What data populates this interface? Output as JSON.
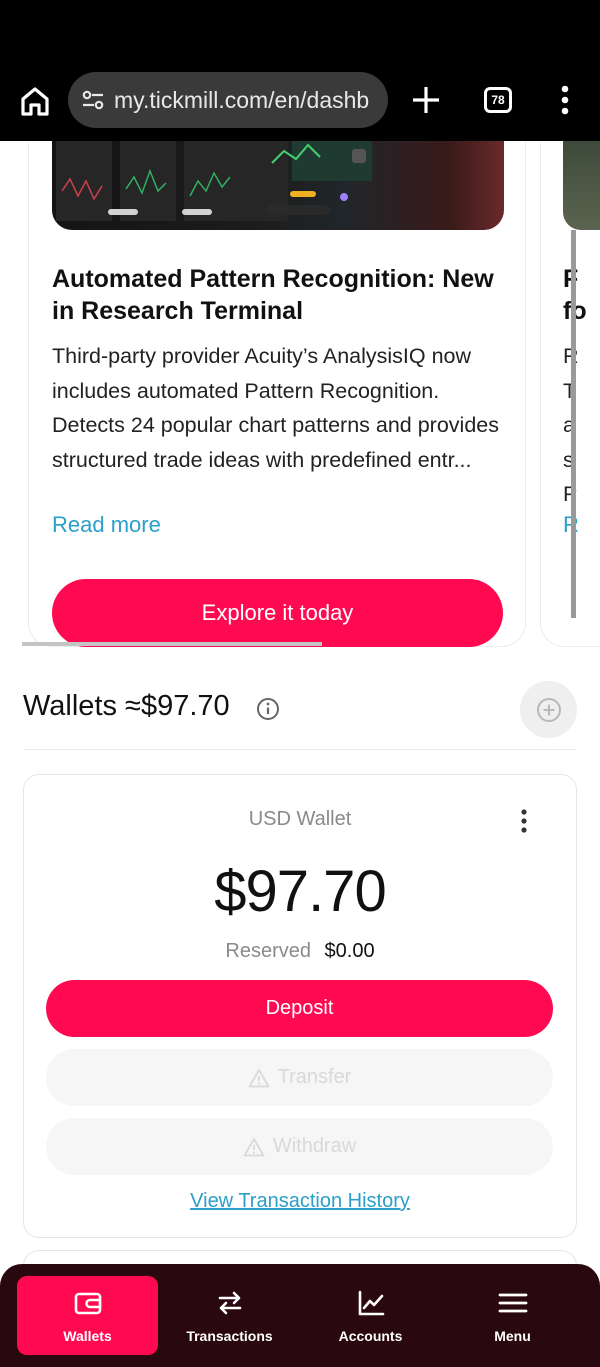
{
  "browser": {
    "url": "my.tickmill.com/en/dashb",
    "tab_count": "78"
  },
  "promo_card": {
    "title": "Automated Pattern Recognition: New in Research Terminal",
    "description": "Third-party provider Acuity’s AnalysisIQ now includes automated Pattern Recognition. Detects 24 popular chart patterns and provides structured trade ideas with predefined entr...",
    "read_more": "Read more",
    "cta": "Explore it today"
  },
  "next_card": {
    "title_partial": "F\nfo",
    "desc_partial": "R\nT\na\ns\nP",
    "link_partial": "R"
  },
  "wallets": {
    "heading": "Wallets ≈$97.70",
    "card": {
      "name": "USD Wallet",
      "balance": "$97.70",
      "reserved_label": "Reserved",
      "reserved_value": "$0.00",
      "deposit_label": "Deposit",
      "transfer_label": "Transfer",
      "withdraw_label": "Withdraw",
      "history_link": "View Transaction History"
    }
  },
  "bottom_nav": {
    "items": [
      {
        "label": "Wallets",
        "icon": "wallet-icon",
        "active": true
      },
      {
        "label": "Transactions",
        "icon": "arrows-swap-icon",
        "active": false
      },
      {
        "label": "Accounts",
        "icon": "chart-line-icon",
        "active": false
      },
      {
        "label": "Menu",
        "icon": "hamburger-icon",
        "active": false
      }
    ]
  },
  "colors": {
    "brand": "#ff0a51",
    "link": "#2a9fc9",
    "nav_bg": "#2a0810"
  }
}
